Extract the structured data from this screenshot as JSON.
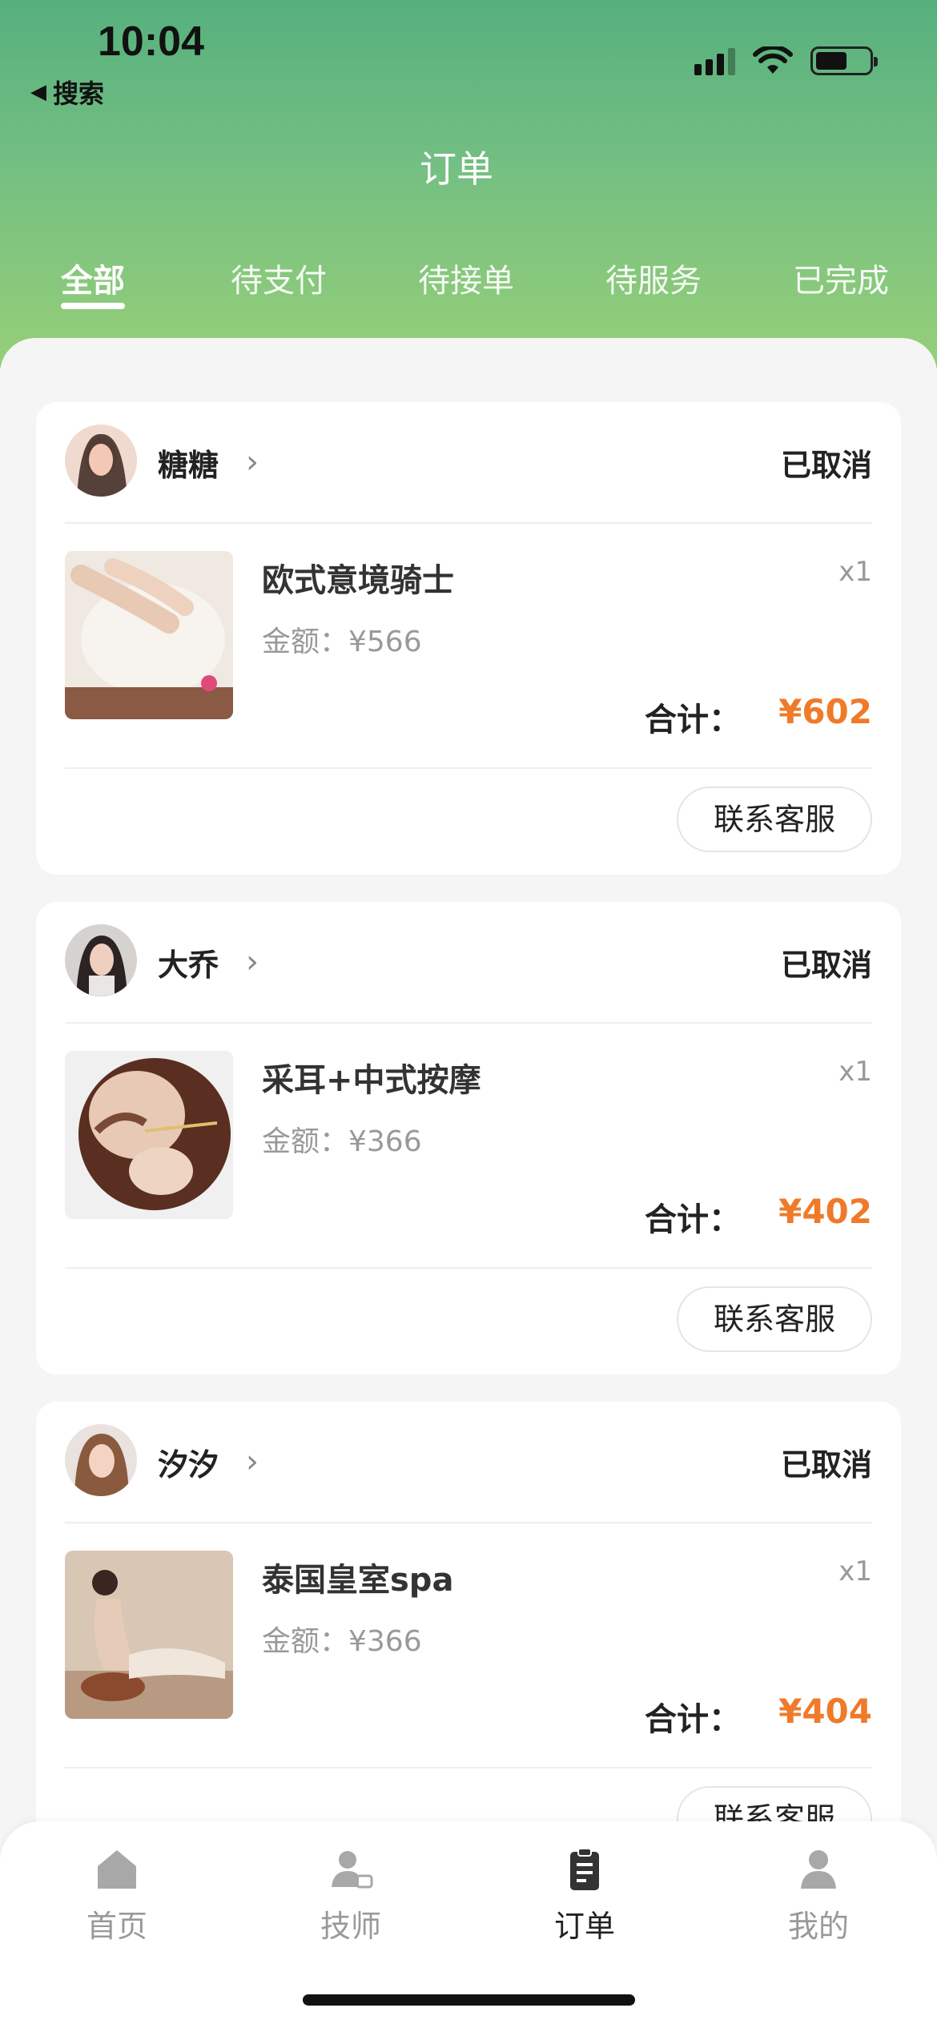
{
  "status_bar": {
    "time": "10:04",
    "back_label": "搜索"
  },
  "header": {
    "title": "订单"
  },
  "tabs": [
    {
      "label": "全部",
      "active": true
    },
    {
      "label": "待支付",
      "active": false
    },
    {
      "label": "待接单",
      "active": false
    },
    {
      "label": "待服务",
      "active": false
    },
    {
      "label": "已完成",
      "active": false
    }
  ],
  "orders": [
    {
      "technician": "糖糖",
      "status": "已取消",
      "service": "欧式意境骑士",
      "qty": "x1",
      "price": "金额：¥566",
      "total_label": "合计：",
      "total": "¥602",
      "button": "联系客服"
    },
    {
      "technician": "大乔",
      "status": "已取消",
      "service": "采耳+中式按摩",
      "qty": "x1",
      "price": "金额：¥366",
      "total_label": "合计：",
      "total": "¥402",
      "button": "联系客服"
    },
    {
      "technician": "汐汐",
      "status": "已取消",
      "service": "泰国皇室spa",
      "qty": "x1",
      "price": "金额：¥366",
      "total_label": "合计：",
      "total": "¥404",
      "button": "联系客服"
    }
  ],
  "tabbar": [
    {
      "label": "首页",
      "icon": "home-icon",
      "active": false
    },
    {
      "label": "技师",
      "icon": "technician-icon",
      "active": false
    },
    {
      "label": "订单",
      "icon": "order-clipboard-icon",
      "active": true
    },
    {
      "label": "我的",
      "icon": "profile-icon",
      "active": false
    }
  ],
  "colors": {
    "accent_green": "#5fb47e",
    "price_orange": "#ef7a2a"
  }
}
